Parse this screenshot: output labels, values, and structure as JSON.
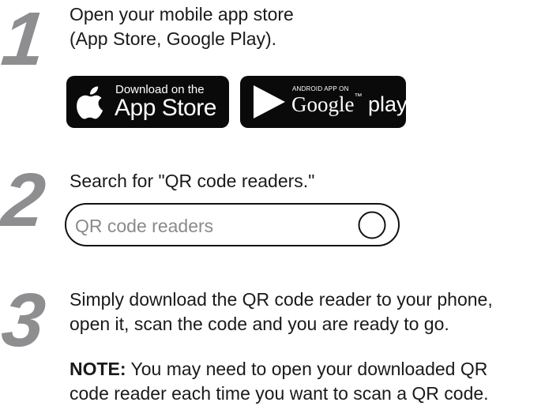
{
  "steps": [
    {
      "number": "1",
      "lines": [
        "Open your mobile app store",
        "(App Store, Google Play)."
      ]
    },
    {
      "number": "2",
      "lines": [
        "Search for \"QR code readers.\""
      ]
    },
    {
      "number": "3",
      "lines": [
        "Simply download the QR code reader to your phone,",
        "open it, scan the code and you are ready to go."
      ]
    }
  ],
  "badges": {
    "app_store": {
      "small_text": "Download on the",
      "big_text": "App Store",
      "icon": "apple-logo-icon"
    },
    "google_play": {
      "small_text": "ANDROID APP ON",
      "big_text": "Google",
      "big_text_suffix": "play",
      "icon": "play-triangle-icon"
    }
  },
  "search": {
    "placeholder": "QR code readers",
    "icon": "search-circle-icon"
  },
  "note": {
    "label": "NOTE:",
    "line1": " You may need to open your downloaded QR",
    "line2": "code reader each time you want to scan a QR code."
  },
  "colors": {
    "step_number": "#8e8e90",
    "badge_bg": "#0a0a0a",
    "text": "#1a1a1a",
    "placeholder": "#8a8a8a"
  }
}
